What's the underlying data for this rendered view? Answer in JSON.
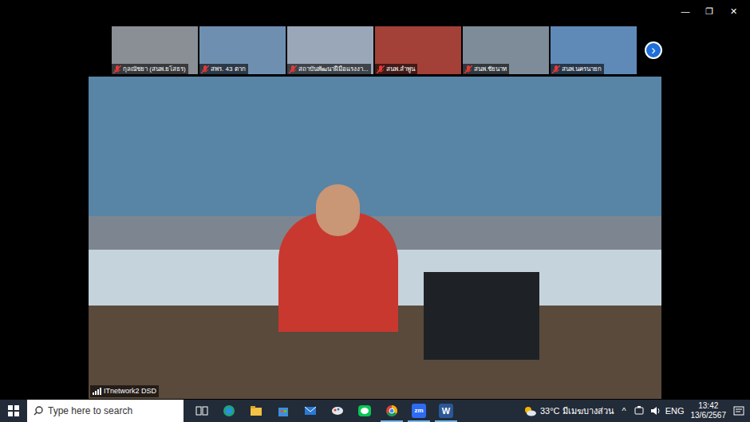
{
  "window": {
    "controls": [
      "—",
      "❐",
      "✕"
    ]
  },
  "gallery": {
    "tiles": [
      {
        "name": "กุลณัชยา (สนพ.ยโสธร)",
        "muted": true
      },
      {
        "name": "สพร. 43 ตาก",
        "muted": true
      },
      {
        "name": "สถาบันพัฒนาฝีมือแรงงา...",
        "muted": true
      },
      {
        "name": "สนพ.ลำพูน",
        "muted": true
      },
      {
        "name": "สนพ.ชัยนาท",
        "muted": true
      },
      {
        "name": "สนพ.นครนายก",
        "muted": true
      }
    ],
    "next": "›"
  },
  "main_video": {
    "label": "ITnetwork2 DSD"
  },
  "taskbar": {
    "search": {
      "placeholder": "Type here to search"
    },
    "apps": [
      {
        "kind": "taskview",
        "active": false
      },
      {
        "kind": "edge",
        "active": false
      },
      {
        "kind": "explorer",
        "active": false
      },
      {
        "kind": "store",
        "active": false
      },
      {
        "kind": "mail",
        "active": false
      },
      {
        "kind": "paint",
        "active": false
      },
      {
        "kind": "line",
        "active": false
      },
      {
        "kind": "chrome",
        "active": true
      },
      {
        "kind": "zoom",
        "glyph": "zm",
        "active": true
      },
      {
        "kind": "word",
        "glyph": "W",
        "active": true
      }
    ],
    "weather": {
      "temp": "33°C",
      "desc": "มีเมฆบางส่วน"
    },
    "tray_expand": "^",
    "language": "ENG",
    "time": "13:42",
    "date": "13/6/2567"
  }
}
